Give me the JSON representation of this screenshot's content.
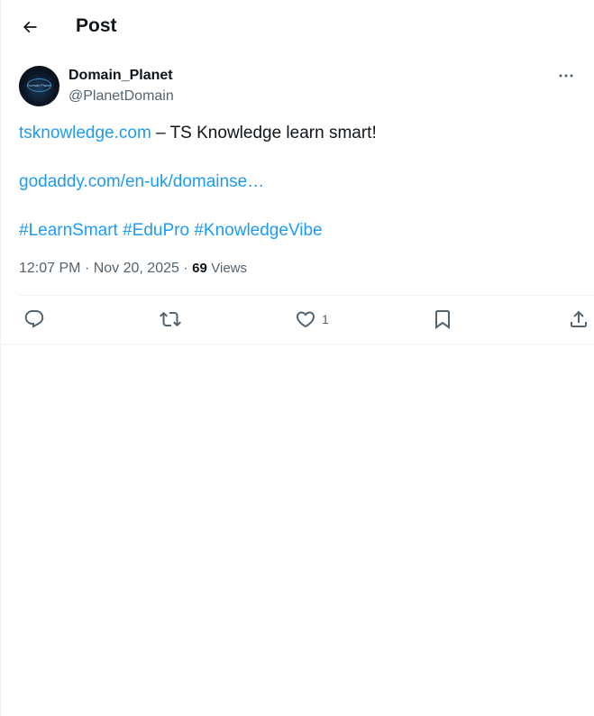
{
  "header": {
    "title": "Post",
    "back_icon": "arrow-left-icon"
  },
  "author": {
    "display_name": "Domain_Planet",
    "handle": "@PlanetDomain",
    "avatar_text": "Domain Planet",
    "more_icon": "more-horizontal-icon"
  },
  "post": {
    "line1_link": "tsknowledge.com",
    "line1_text": " – TS Knowledge learn smart!",
    "line2_link": "godaddy.com/en-uk/domainse…",
    "hashtags": [
      "#LearnSmart",
      "#EduPro",
      "#KnowledgeVibe"
    ]
  },
  "meta": {
    "time": "12:07 PM",
    "separator": " · ",
    "date": "Nov 20, 2025",
    "views_count": "69",
    "views_label": "Views"
  },
  "actions": {
    "reply_icon": "reply-icon",
    "repost_icon": "repost-icon",
    "like_icon": "heart-icon",
    "like_count": "1",
    "bookmark_icon": "bookmark-icon",
    "share_icon": "share-icon"
  },
  "colors": {
    "link": "#1d9bf0",
    "text": "#0f1419",
    "muted": "#536471",
    "divider": "#eff3f4"
  }
}
